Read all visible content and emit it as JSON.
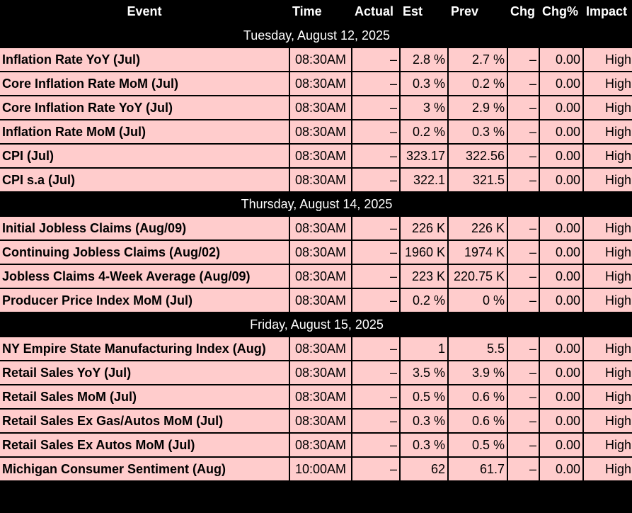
{
  "headers": {
    "event": "Event",
    "time": "Time",
    "actual": "Actual",
    "est": "Est",
    "prev": "Prev",
    "chg": "Chg",
    "chg_pct": "Chg%",
    "impact": "Impact"
  },
  "colors": {
    "row_bg": "#ffcccc",
    "header_bg": "#000000",
    "header_text": "#ffffff"
  },
  "groups": [
    {
      "date": "Tuesday, August 12, 2025",
      "rows": [
        {
          "event": "Inflation Rate YoY (Jul)",
          "time": "08:30AM",
          "actual": "–",
          "est": "2.8 %",
          "prev": "2.7 %",
          "chg": "–",
          "chg_pct": "0.00",
          "impact": "High"
        },
        {
          "event": "Core Inflation Rate MoM (Jul)",
          "time": "08:30AM",
          "actual": "–",
          "est": "0.3 %",
          "prev": "0.2 %",
          "chg": "–",
          "chg_pct": "0.00",
          "impact": "High"
        },
        {
          "event": "Core Inflation Rate YoY (Jul)",
          "time": "08:30AM",
          "actual": "–",
          "est": "3 %",
          "prev": "2.9 %",
          "chg": "–",
          "chg_pct": "0.00",
          "impact": "High"
        },
        {
          "event": "Inflation Rate MoM (Jul)",
          "time": "08:30AM",
          "actual": "–",
          "est": "0.2 %",
          "prev": "0.3 %",
          "chg": "–",
          "chg_pct": "0.00",
          "impact": "High"
        },
        {
          "event": "CPI (Jul)",
          "time": "08:30AM",
          "actual": "–",
          "est": "323.17",
          "prev": "322.56",
          "chg": "–",
          "chg_pct": "0.00",
          "impact": "High"
        },
        {
          "event": "CPI s.a (Jul)",
          "time": "08:30AM",
          "actual": "–",
          "est": "322.1",
          "prev": "321.5",
          "chg": "–",
          "chg_pct": "0.00",
          "impact": "High"
        }
      ]
    },
    {
      "date": "Thursday, August 14, 2025",
      "rows": [
        {
          "event": "Initial Jobless Claims (Aug/09)",
          "time": "08:30AM",
          "actual": "–",
          "est": "226 K",
          "prev": "226 K",
          "chg": "–",
          "chg_pct": "0.00",
          "impact": "High"
        },
        {
          "event": "Continuing Jobless Claims (Aug/02)",
          "time": "08:30AM",
          "actual": "–",
          "est": "1960 K",
          "prev": "1974 K",
          "chg": "–",
          "chg_pct": "0.00",
          "impact": "High"
        },
        {
          "event": "Jobless Claims 4-Week Average (Aug/09)",
          "time": "08:30AM",
          "actual": "–",
          "est": "223 K",
          "prev": "220.75 K",
          "chg": "–",
          "chg_pct": "0.00",
          "impact": "High"
        },
        {
          "event": "Producer Price Index MoM (Jul)",
          "time": "08:30AM",
          "actual": "–",
          "est": "0.2 %",
          "prev": "0 %",
          "chg": "–",
          "chg_pct": "0.00",
          "impact": "High"
        }
      ]
    },
    {
      "date": "Friday, August 15, 2025",
      "rows": [
        {
          "event": "NY Empire State Manufacturing Index (Aug)",
          "time": "08:30AM",
          "actual": "–",
          "est": "1",
          "prev": "5.5",
          "chg": "–",
          "chg_pct": "0.00",
          "impact": "High"
        },
        {
          "event": "Retail Sales YoY (Jul)",
          "time": "08:30AM",
          "actual": "–",
          "est": "3.5 %",
          "prev": "3.9 %",
          "chg": "–",
          "chg_pct": "0.00",
          "impact": "High"
        },
        {
          "event": "Retail Sales MoM (Jul)",
          "time": "08:30AM",
          "actual": "–",
          "est": "0.5 %",
          "prev": "0.6 %",
          "chg": "–",
          "chg_pct": "0.00",
          "impact": "High"
        },
        {
          "event": "Retail Sales Ex Gas/Autos MoM (Jul)",
          "time": "08:30AM",
          "actual": "–",
          "est": "0.3 %",
          "prev": "0.6 %",
          "chg": "–",
          "chg_pct": "0.00",
          "impact": "High"
        },
        {
          "event": "Retail Sales Ex Autos MoM (Jul)",
          "time": "08:30AM",
          "actual": "–",
          "est": "0.3 %",
          "prev": "0.5 %",
          "chg": "–",
          "chg_pct": "0.00",
          "impact": "High"
        },
        {
          "event": "Michigan Consumer Sentiment (Aug)",
          "time": "10:00AM",
          "actual": "–",
          "est": "62",
          "prev": "61.7",
          "chg": "–",
          "chg_pct": "0.00",
          "impact": "High"
        }
      ]
    }
  ]
}
